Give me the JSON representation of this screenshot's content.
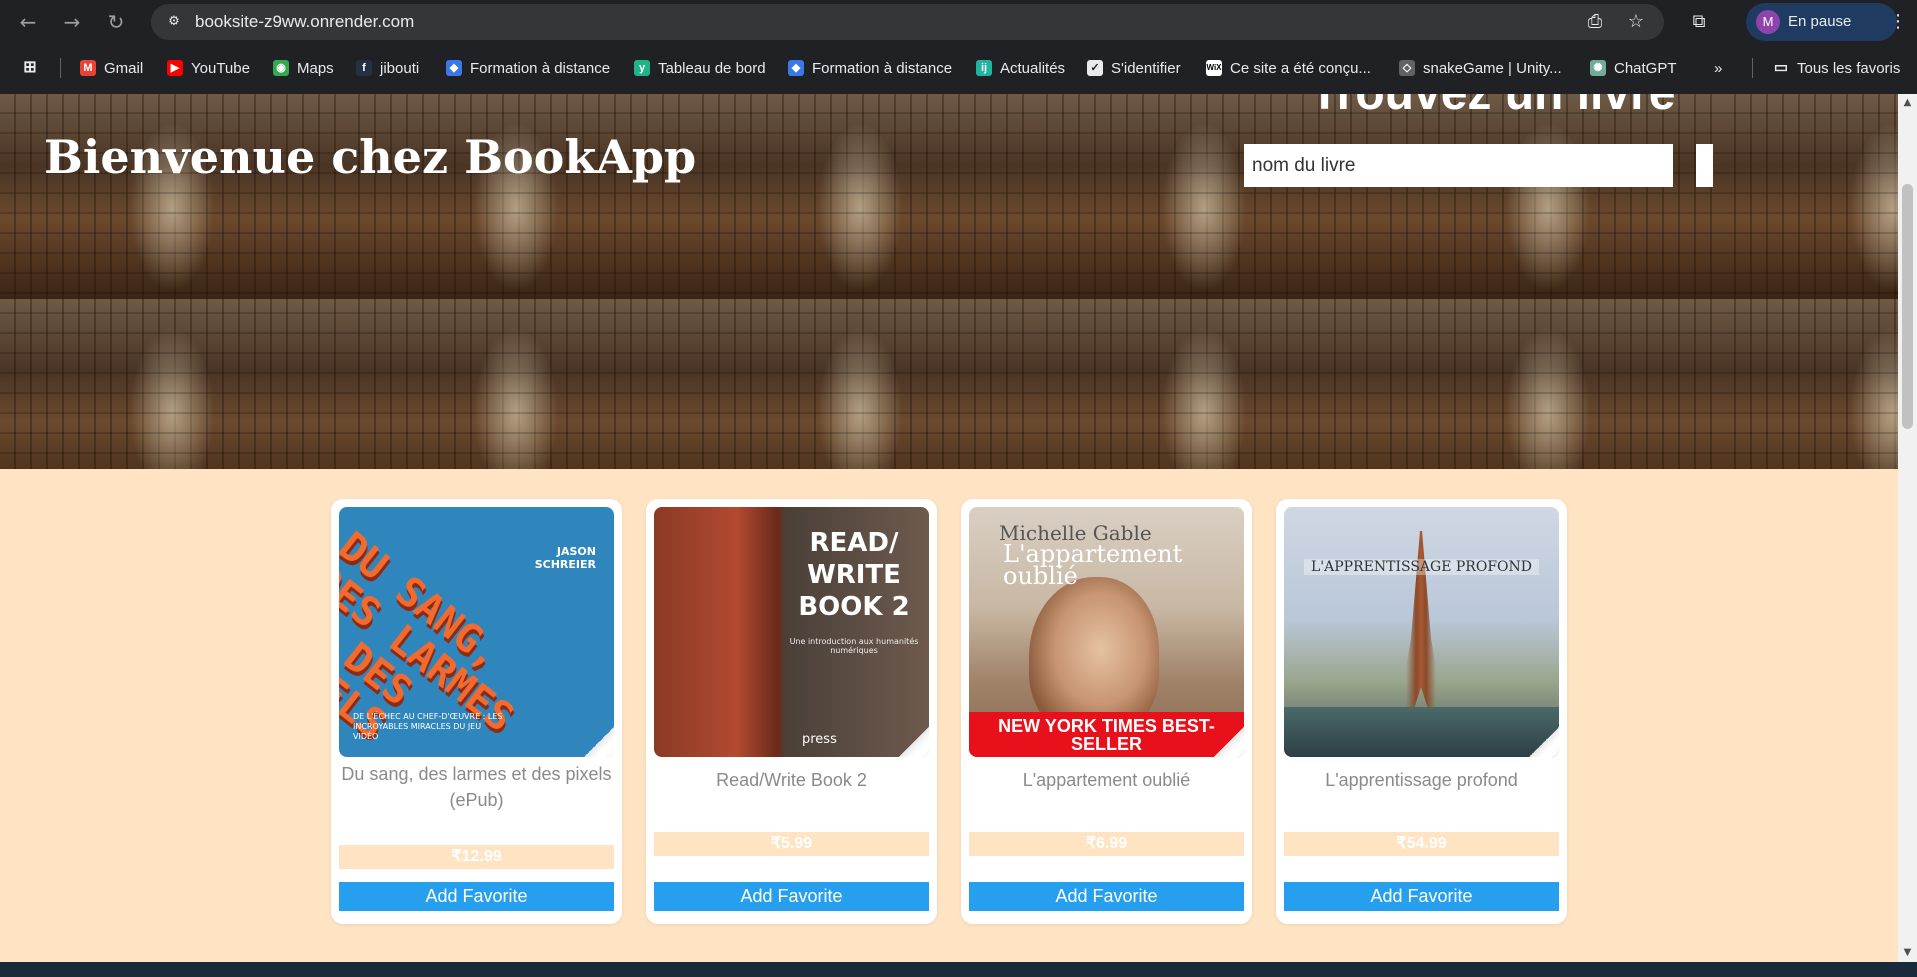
{
  "browser": {
    "url": "booksite-z9ww.onrender.com",
    "profile_initial": "M",
    "profile_label": "En pause",
    "bookmarks": [
      {
        "label": "Gmail",
        "icon": "gmail-icon"
      },
      {
        "label": "YouTube",
        "icon": "youtube-icon"
      },
      {
        "label": "Maps",
        "icon": "maps-icon"
      },
      {
        "label": "jibouti",
        "icon": "jibouti-icon"
      },
      {
        "label": "Formation à distance",
        "icon": "formation-icon"
      },
      {
        "label": "Tableau de bord",
        "icon": "tableau-icon"
      },
      {
        "label": "Formation à distance",
        "icon": "formation-icon"
      },
      {
        "label": "Actualités",
        "icon": "actualites-icon"
      },
      {
        "label": "S'identifier",
        "icon": "identifier-icon"
      },
      {
        "label": "Ce site a été conçu...",
        "icon": "wix-icon"
      },
      {
        "label": "snakeGame | Unity...",
        "icon": "unity-icon"
      },
      {
        "label": "ChatGPT",
        "icon": "chatgpt-icon"
      }
    ],
    "more_bookmarks": "»",
    "all_bookmarks": "Tous les favoris"
  },
  "hero": {
    "title": "Bienvenue chez BookApp",
    "search_title": "Trouvez un livre",
    "search_placeholder": "nom du livre"
  },
  "books": [
    {
      "title": "Du sang, des larmes et des pixels (ePub)",
      "price": "₹12.99",
      "button": "Add Favorite",
      "cover": {
        "big": "DU SANG, DES LARMES ET DES PIXELS",
        "author": "JASON SCHREIER",
        "sub": "DE L'ÉCHEC AU CHEF-D'ŒUVRE : LES INCROYABLES MIRACLES DU JEU VIDÉO"
      }
    },
    {
      "title": "Read/Write Book 2",
      "price": "₹5.99",
      "button": "Add Favorite",
      "cover": {
        "big": "READ/ WRITE BOOK 2",
        "sub": "Une introduction aux humanités numériques",
        "press": "press"
      }
    },
    {
      "title": "L'appartement oublié",
      "price": "₹6.99",
      "button": "Add Favorite",
      "cover": {
        "author": "Michelle Gable",
        "big": "L'appartement oublié",
        "banner": "NEW YORK TIMES BEST-SELLER"
      }
    },
    {
      "title": "L'apprentissage profond",
      "price": "₹54.99",
      "button": "Add Favorite",
      "cover": {
        "big": "L'APPRENTISSAGE PROFOND"
      }
    }
  ],
  "colors": {
    "page_bg": "#ffe4c4",
    "button_blue": "#26a0ee",
    "price_bg": "#ffe4c4"
  }
}
